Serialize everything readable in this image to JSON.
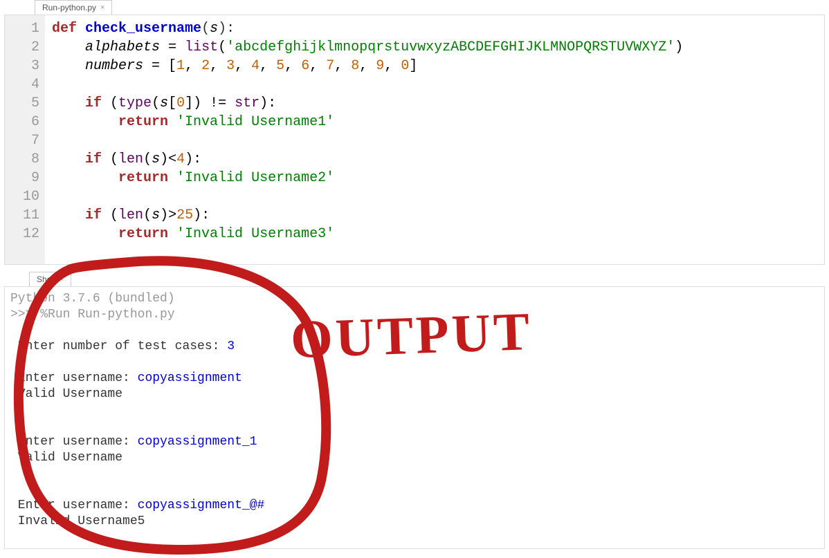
{
  "editor": {
    "tab_name": "Run-python.py",
    "lines": [
      "1",
      "2",
      "3",
      "4",
      "5",
      "6",
      "7",
      "8",
      "9",
      "10",
      "11",
      "12"
    ],
    "code": {
      "l1": {
        "def": "def",
        "fn": "check_username",
        "p_open": "(",
        "s": "s",
        "p_close": "):"
      },
      "l2": {
        "indent": "    ",
        "alphabets": "alphabets",
        "eq": " = ",
        "list": "list",
        "p_open": "(",
        "str": "'abcdefghijklmnopqrstuvwxyzABCDEFGHIJKLMNOPQRSTUVWXYZ'",
        "p_close": ")"
      },
      "l3": {
        "indent": "    ",
        "numbers": "numbers",
        "eq": " = [",
        "n1": "1",
        "n2": "2",
        "n3": "3",
        "n4": "4",
        "n5": "5",
        "n6": "6",
        "n7": "7",
        "n8": "8",
        "n9": "9",
        "n0": "0",
        "close": "]",
        "comma": ", "
      },
      "l5": {
        "indent": "    ",
        "if": "if",
        "p_open": " (",
        "type": "type",
        "po2": "(",
        "s": "s",
        "br": "[",
        "zero": "0",
        "brc": "]) != ",
        "str": "str",
        "pc": "):"
      },
      "l6": {
        "indent": "        ",
        "return": "return",
        "sp": " ",
        "str": "'Invalid Username1'"
      },
      "l8": {
        "indent": "    ",
        "if": "if",
        "p_open": " (",
        "len": "len",
        "po2": "(",
        "s": "s",
        "pc2": ")<",
        "four": "4",
        "pc": "):"
      },
      "l9": {
        "indent": "        ",
        "return": "return",
        "sp": " ",
        "str": "'Invalid Username2'"
      },
      "l11": {
        "indent": "    ",
        "if": "if",
        "p_open": " (",
        "len": "len",
        "po2": "(",
        "s": "s",
        "pc2": ")>",
        "n": "25",
        "pc": "):"
      },
      "l12": {
        "indent": "        ",
        "return": "return",
        "sp": " ",
        "str": "'Invalid Username3'"
      }
    }
  },
  "shell": {
    "tab_name": "Shell",
    "banner": "Python 3.7.6 (bundled)",
    "prompt": ">>> ",
    "run_cmd": "%Run Run-python.py",
    "lines": {
      "tc_prompt": " Enter number of test cases: ",
      "tc_val": "3",
      "u1_prompt": " Enter username: ",
      "u1_val": "copyassignment",
      "u1_res": " Valid Username",
      "u2_prompt": " Enter username: ",
      "u2_val": "copyassignment_1",
      "u2_res": " Valid Username",
      "u3_prompt": " Enter username: ",
      "u3_val": "copyassignment_@#",
      "u3_res": " Invalid Username5"
    }
  },
  "annotation": {
    "label": "OUTPUT",
    "color": "#c21b1b"
  }
}
